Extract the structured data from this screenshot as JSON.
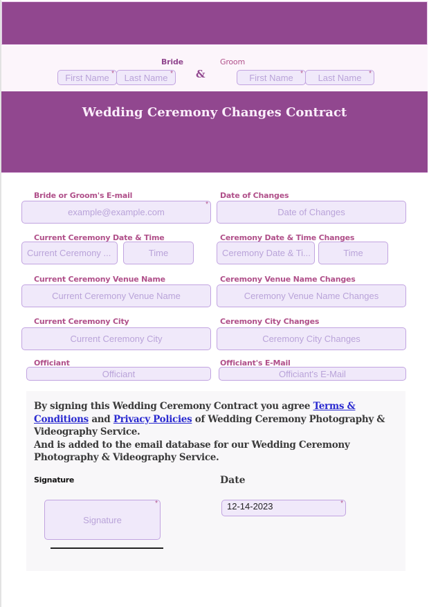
{
  "header": {
    "title": "Wedding Ceremony Changes Contract"
  },
  "couple": {
    "bride_label": "Bride",
    "groom_label": "Groom",
    "ampersand": "&",
    "bride_first_placeholder": "First Name",
    "bride_last_placeholder": "Last Name",
    "groom_first_placeholder": "First Name",
    "groom_last_placeholder": "Last Name",
    "required_mark": "*"
  },
  "fields": {
    "email": {
      "label": "Bride or Groom's E-mail",
      "placeholder": "example@example.com"
    },
    "date_of_changes": {
      "label": "Date of Changes",
      "placeholder": "Date of Changes"
    },
    "current_datetime": {
      "label": "Current Ceremony Date & Time",
      "date_placeholder": "Current Ceremony ...",
      "time_placeholder": "Time"
    },
    "datetime_changes": {
      "label": "Ceremony Date & Time Changes",
      "date_placeholder": "Ceremony Date & Ti...",
      "time_placeholder": "Time"
    },
    "current_venue": {
      "label": "Current Ceremony Venue Name",
      "placeholder": "Current Ceremony Venue Name"
    },
    "venue_changes": {
      "label": "Ceremony Venue Name Changes",
      "placeholder": "Ceremony Venue Name Changes"
    },
    "current_city": {
      "label": "Current Ceremony City",
      "placeholder": "Current Ceremony City"
    },
    "city_changes": {
      "label": "Ceremony City Changes",
      "placeholder": "Ceremony City Changes"
    },
    "officiant": {
      "label": "Officiant",
      "placeholder": "Officiant"
    },
    "officiant_email": {
      "label": "Officiant's E-Mail",
      "placeholder": "Officiant's E-Mail"
    }
  },
  "agreement": {
    "text_1": "By signing this Wedding Ceremony Contract you agree ",
    "terms_link": "Terms & Conditions",
    "text_2": " and ",
    "privacy_link": "Privacy Policies",
    "text_3": " of Wedding Ceremony Photography & Videography Service.",
    "text_4": "And is added to the email database for our Wedding Ceremony Photography & Videography Service."
  },
  "signature": {
    "label": "Signature",
    "placeholder": "Signature",
    "date_label": "Date",
    "date_value": "12-14-2023"
  },
  "colors": {
    "brand_purple": "#91478f",
    "label_color": "#b0508a",
    "field_bg": "#f0e9fa",
    "field_border": "#c1a3e0",
    "link_color": "#2a2ad0"
  }
}
